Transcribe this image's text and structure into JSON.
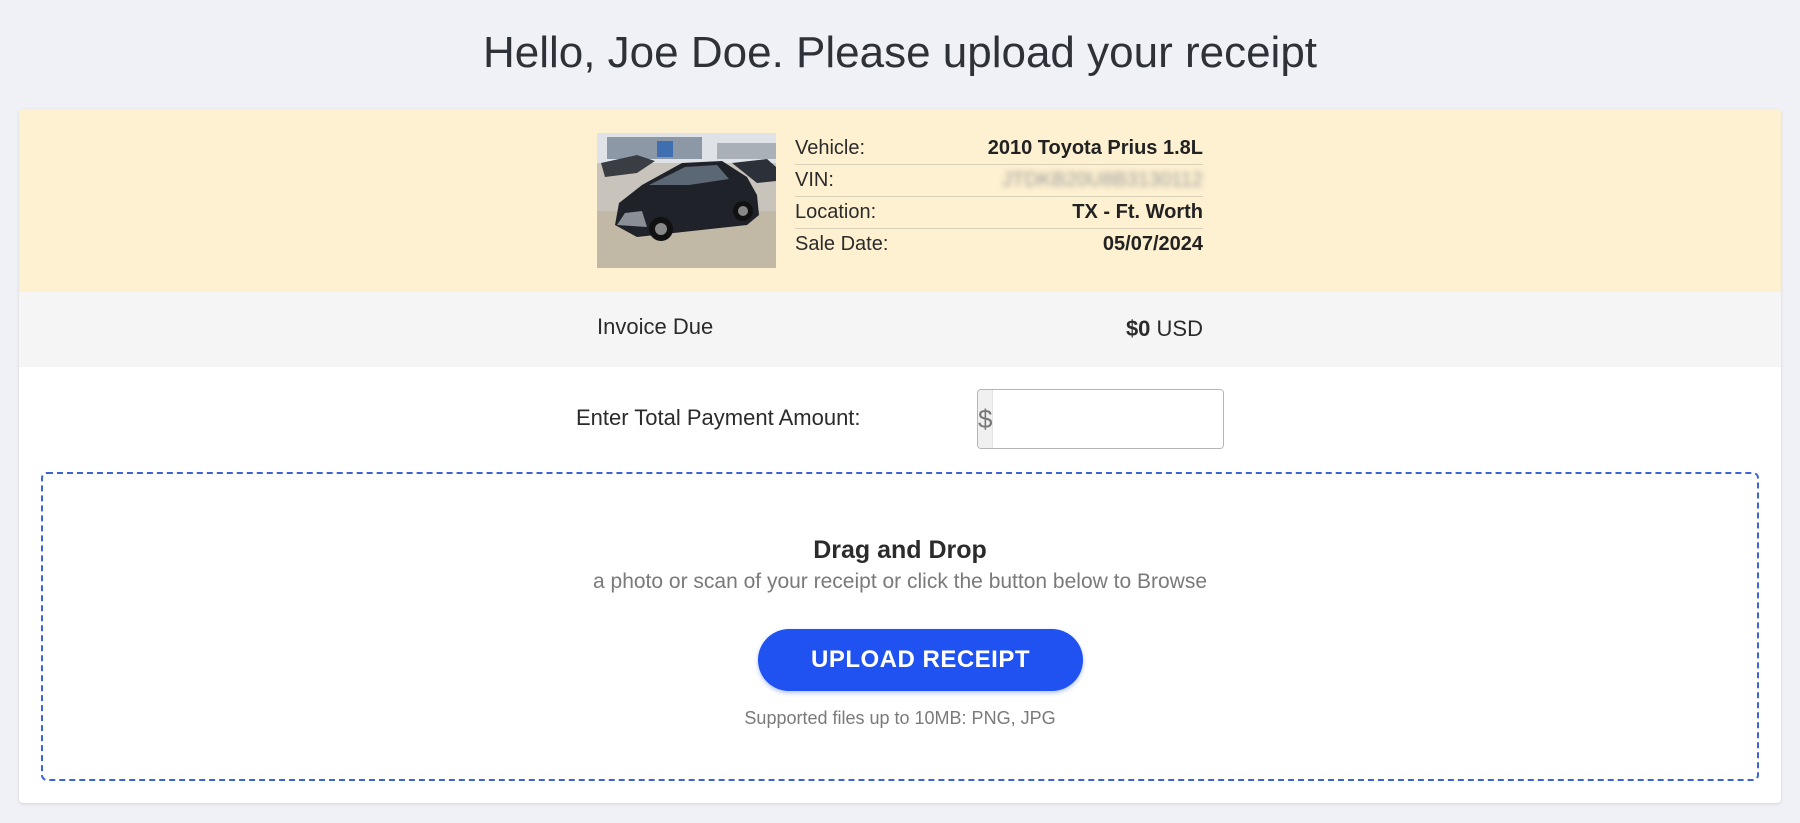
{
  "header": {
    "title": "Hello, Joe Doe. Please upload your receipt"
  },
  "vehicle": {
    "photo_alt": "vehicle-photo",
    "rows": [
      {
        "label": "Vehicle:",
        "value": "2010 Toyota Prius 1.8L"
      },
      {
        "label": "VIN:",
        "value": "JTDKB20U8B3130112"
      },
      {
        "label": "Location:",
        "value": "TX - Ft. Worth"
      },
      {
        "label": "Sale Date:",
        "value": "05/07/2024"
      }
    ]
  },
  "invoice": {
    "label": "Invoice Due",
    "amount": "$0",
    "currency": "USD"
  },
  "payment": {
    "label": "Enter Total Payment Amount:",
    "currency_symbol": "$",
    "value": "",
    "placeholder": ""
  },
  "dropzone": {
    "title": "Drag and Drop",
    "subtitle": "a photo or scan of your receipt or click the button below to Browse",
    "button_label": "UPLOAD RECEIPT",
    "note": "Supported files up to 10MB: PNG, JPG"
  },
  "colors": {
    "background": "#f0f1f6",
    "vehicle_band": "#fef1d1",
    "invoice_band": "#f5f5f5",
    "accent": "#1f52f0",
    "dropzone_border": "#3d63d6"
  }
}
